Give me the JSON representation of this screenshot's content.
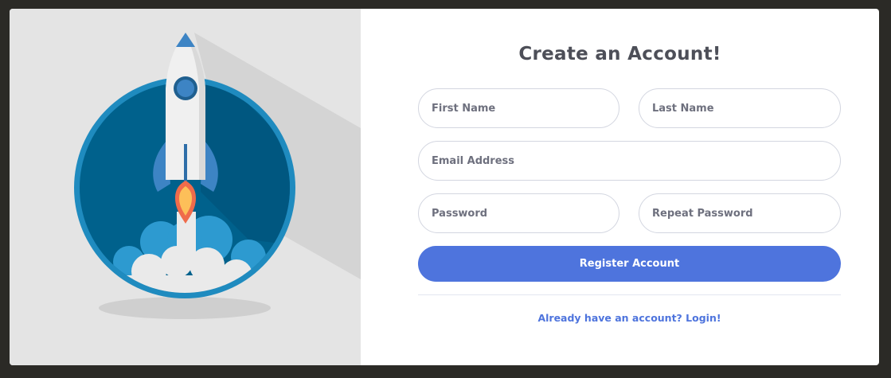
{
  "form": {
    "title": "Create an Account!",
    "first_name_placeholder": "First Name",
    "last_name_placeholder": "Last Name",
    "email_placeholder": "Email Address",
    "password_placeholder": "Password",
    "repeat_password_placeholder": "Repeat Password",
    "register_label": "Register Account",
    "login_link_label": "Already have an account? Login!"
  },
  "colors": {
    "accent": "#4e74dd",
    "panel_background": "#e4e4e4",
    "circle_outer": "#1f8bbf",
    "circle_inner": "#00618c"
  },
  "illustration": {
    "icon": "rocket-launch-icon"
  }
}
